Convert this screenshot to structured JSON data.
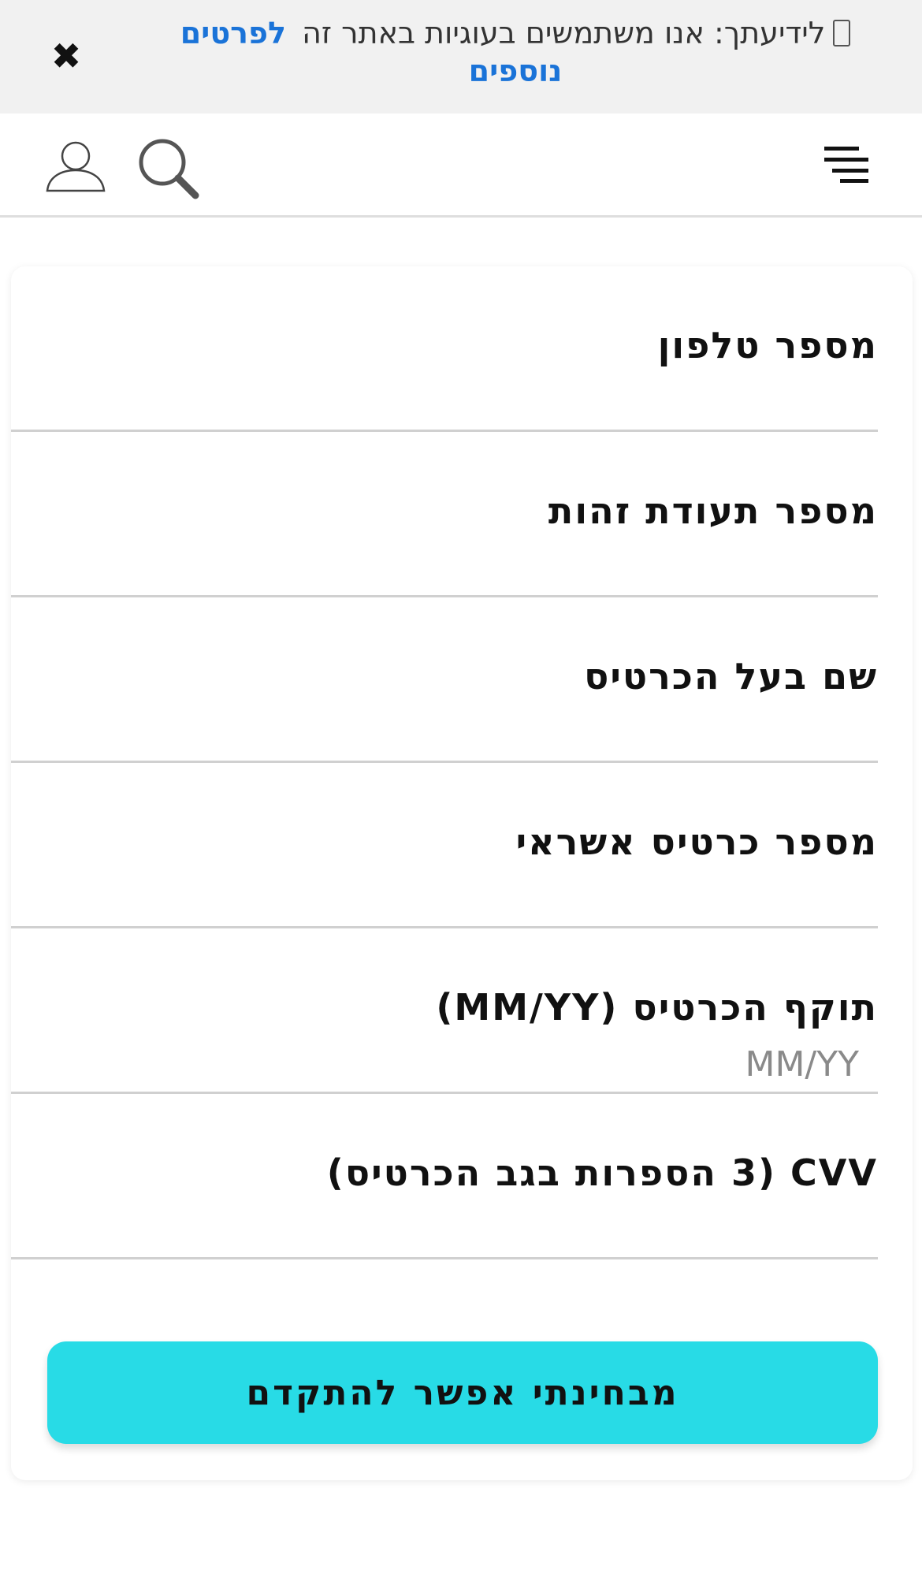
{
  "cookie_banner": {
    "text": "לידיעתך: אנו משתמשים בעוגיות באתר זה",
    "link_label": "לפרטים נוספים",
    "close_label": "✖"
  },
  "form": {
    "fields": [
      {
        "label": "מספר טלפון",
        "value": "",
        "placeholder": ""
      },
      {
        "label": "מספר תעודת זהות",
        "value": "",
        "placeholder": ""
      },
      {
        "label": "שם בעל הכרטיס",
        "value": "",
        "placeholder": ""
      },
      {
        "label": "מספר כרטיס אשראי",
        "value": "",
        "placeholder": ""
      },
      {
        "label": "תוקף הכרטיס (MM/YY)",
        "value": "",
        "placeholder": "MM/YY"
      },
      {
        "label": "CVV (3 הספרות בגב הכרטיס)",
        "value": "",
        "placeholder": ""
      }
    ],
    "submit_label": "מבחינתי אפשר להתקדם"
  },
  "colors": {
    "accent": "#28dbe6",
    "link": "#1a73d8",
    "banner_bg": "#f1f1f1"
  },
  "icons": [
    "user-icon",
    "search-icon",
    "menu-icon",
    "cookie-icon",
    "close-icon"
  ]
}
